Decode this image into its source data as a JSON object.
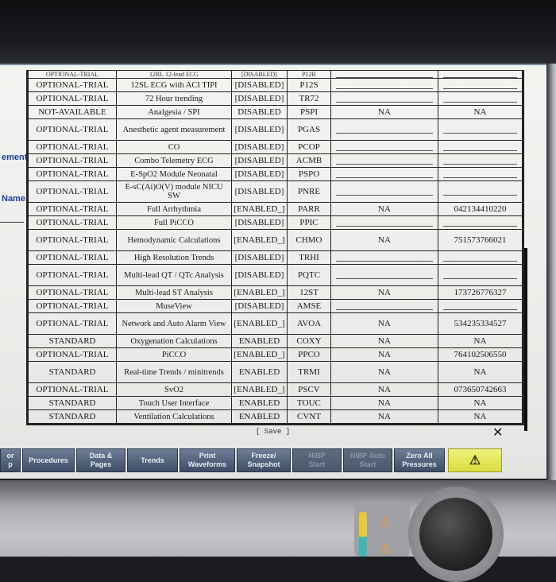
{
  "left_menu": {
    "item1": "ement",
    "item2": "Name"
  },
  "table": {
    "cut_row": [
      "OPTIONAL-TRIAL",
      "12RL 12-lead ECG",
      "[DISABLED]",
      "P12R"
    ],
    "rows": [
      {
        "status": "OPTIONAL-TRIAL",
        "feature": "12SL ECG with ACI TIPI",
        "state": "[DISABLED]",
        "code": "P12S",
        "extra1": "",
        "extra2": ""
      },
      {
        "status": "OPTIONAL-TRIAL",
        "feature": "72 Hour trending",
        "state": "[DISABLED]",
        "code": "TR72",
        "extra1": "",
        "extra2": ""
      },
      {
        "status": "NOT-AVAILABLE",
        "feature": "Analgesia / SPI",
        "state": "DISABLED",
        "code": "PSPI",
        "extra1": "NA",
        "extra2": "NA"
      },
      {
        "status": "OPTIONAL-TRIAL",
        "feature": "Anesthetic agent measurement",
        "state": "[DISABLED]",
        "code": "PGAS",
        "extra1": "",
        "extra2": "",
        "tall": true
      },
      {
        "status": "OPTIONAL-TRIAL",
        "feature": "CO",
        "state": "[DISABLED]",
        "code": "PCOP",
        "extra1": "",
        "extra2": ""
      },
      {
        "status": "OPTIONAL-TRIAL",
        "feature": "Combo Telemetry ECG",
        "state": "[DISABLED]",
        "code": "ACMB",
        "extra1": "",
        "extra2": ""
      },
      {
        "status": "OPTIONAL-TRIAL",
        "feature": "E-SpO2 Module Neonatal",
        "state": "[DISABLED]",
        "code": "PSPO",
        "extra1": "",
        "extra2": ""
      },
      {
        "status": "OPTIONAL-TRIAL",
        "feature": "E-sC(Ai)O(V) module NICU SW",
        "state": "[DISABLED]",
        "code": "PNRE",
        "extra1": "",
        "extra2": "",
        "tall": true
      },
      {
        "status": "OPTIONAL-TRIAL",
        "feature": "Full Arrhythmia",
        "state": "[ENABLED_]",
        "code": "PARR",
        "extra1": "NA",
        "extra2": "042134410220"
      },
      {
        "status": "OPTIONAL-TRIAL",
        "feature": "Full PiCCO",
        "state": "[DISABLED]",
        "code": "PPIC",
        "extra1": "",
        "extra2": ""
      },
      {
        "status": "OPTIONAL-TRIAL",
        "feature": "Hemodynamic Calculations",
        "state": "[ENABLED_]",
        "code": "CHMO",
        "extra1": "NA",
        "extra2": "751573766021",
        "tall": true
      },
      {
        "status": "OPTIONAL-TRIAL",
        "feature": "High Resolution Trends",
        "state": "[DISABLED]",
        "code": "TRHI",
        "extra1": "",
        "extra2": ""
      },
      {
        "status": "OPTIONAL-TRIAL",
        "feature": "Multi-lead QT / QTc Analysis",
        "state": "[DISABLED]",
        "code": "PQTC",
        "extra1": "",
        "extra2": "",
        "tall": true
      },
      {
        "status": "OPTIONAL-TRIAL",
        "feature": "Multi-lead ST Analysis",
        "state": "[ENABLED_]",
        "code": "12ST",
        "extra1": "NA",
        "extra2": "173726776327"
      },
      {
        "status": "OPTIONAL-TRIAL",
        "feature": "MuseView",
        "state": "[DISABLED]",
        "code": "AMSE",
        "extra1": "",
        "extra2": ""
      },
      {
        "status": "OPTIONAL-TRIAL",
        "feature": "Network and Auto Alarm View",
        "state": "[ENABLED_]",
        "code": "AVOA",
        "extra1": "NA",
        "extra2": "534235334527",
        "tall": true
      },
      {
        "status": "STANDARD",
        "feature": "Oxygenation Calculations",
        "state": "ENABLED",
        "code": "COXY",
        "extra1": "NA",
        "extra2": "NA"
      },
      {
        "status": "OPTIONAL-TRIAL",
        "feature": "PiCCO",
        "state": "[ENABLED_]",
        "code": "PPCO",
        "extra1": "NA",
        "extra2": "764102506550"
      },
      {
        "status": "STANDARD",
        "feature": "Real-time Trends / minitrends",
        "state": "ENABLED",
        "code": "TRMI",
        "extra1": "NA",
        "extra2": "NA",
        "tall": true
      },
      {
        "status": "OPTIONAL-TRIAL",
        "feature": "SvO2",
        "state": "[ENABLED_]",
        "code": "PSCV",
        "extra1": "NA",
        "extra2": "073650742663"
      },
      {
        "status": "STANDARD",
        "feature": "Touch User Interface",
        "state": "ENABLED",
        "code": "TOUC",
        "extra1": "NA",
        "extra2": "NA"
      },
      {
        "status": "STANDARD",
        "feature": "Ventilation Calculations",
        "state": "ENABLED",
        "code": "CVNT",
        "extra1": "NA",
        "extra2": "NA"
      }
    ]
  },
  "save_label": "[ Save ]",
  "close_glyph": "✕",
  "softkeys": [
    {
      "label": "or\np",
      "dim": false
    },
    {
      "label": "Procedures",
      "dim": false
    },
    {
      "label": "Data &\nPages",
      "dim": false
    },
    {
      "label": "Trends",
      "dim": false
    },
    {
      "label": "Print\nWaveforms",
      "dim": false
    },
    {
      "label": "Freeze/\nSnapshot",
      "dim": false
    },
    {
      "label": "NIBP\nStart",
      "dim": true
    },
    {
      "label": "NIBP Auto\nStart",
      "dim": true
    },
    {
      "label": "Zero All\nPressures",
      "dim": false
    }
  ],
  "alarm_glyph": "⚠",
  "led_glyph": "⚠",
  "colors": {
    "menu_text": "#1f3e9a",
    "softkey": "#52627b",
    "alarm_key": "#dfe24a",
    "led": "#ff9a1c"
  }
}
